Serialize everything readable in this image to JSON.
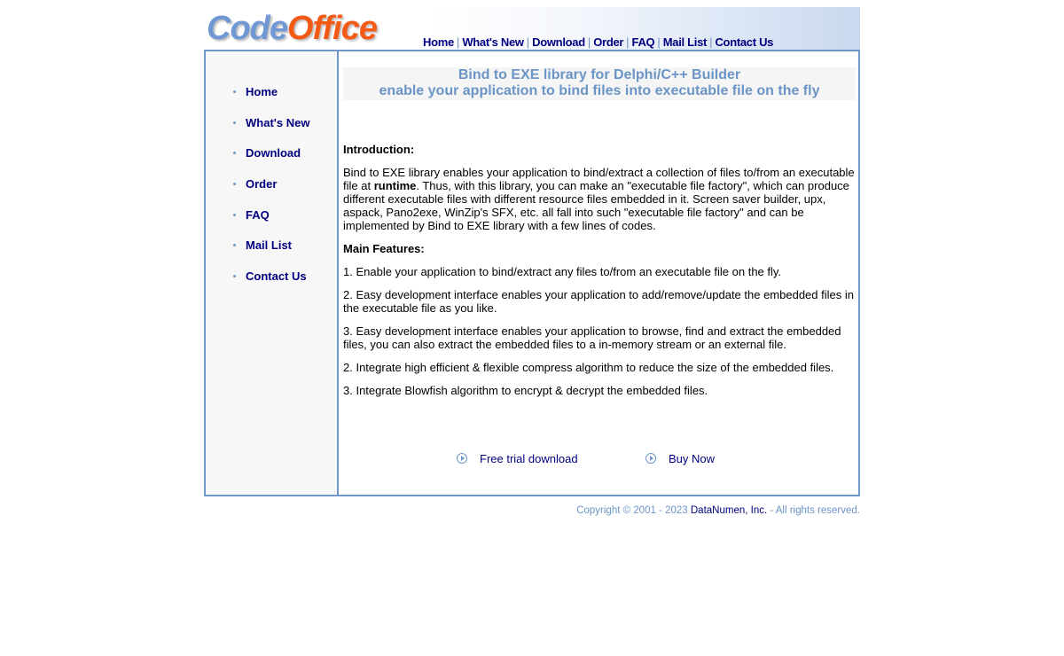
{
  "logo": {
    "part1": "Code",
    "part2": "Office"
  },
  "topnav": [
    "Home",
    "What's New",
    "Download",
    "Order",
    "FAQ",
    "Mail List",
    "Contact Us"
  ],
  "topnav_separator": "|",
  "sidebar": {
    "items": [
      "Home",
      "What's New",
      "Download",
      "Order",
      "FAQ",
      "Mail List",
      "Contact Us"
    ]
  },
  "main": {
    "title_line1": "Bind to EXE library for Delphi/C++ Builder",
    "title_line2": "enable your application to bind files into executable file on the fly",
    "intro_heading": "Introduction:",
    "intro_before_bold": "Bind to EXE library enables your application to bind/extract a collection of files to/from an executable file at ",
    "intro_bold": "runtime",
    "intro_after_bold": ". Thus, with this library, you can make an \"executable file factory\", which can produce different executable files with different resource files embedded in it. Screen saver builder, upx, aspack, Pano2exe, WinZip's SFX, etc. all fall into such \"executable file factory\" and can be implemented by Bind to EXE library with a few lines of codes.",
    "features_heading": "Main Features:",
    "features": [
      "1. Enable your application to bind/extract any files to/from an executable file on the fly.",
      "2. Easy development interface enables your application to add/remove/update the embedded files in the executable file as you like.",
      "3. Easy development interface enables your application to browse, find and extract the embedded files, you can also extract the embedded files to a in-memory stream or an external file.",
      "2. Integrate high efficient & flexible compress algorithm to reduce the size of the embedded files.",
      "3. Integrate Blowfish algorithm to encrypt & decrypt the embedded files."
    ],
    "actions": {
      "trial": "Free trial download",
      "buy": "Buy Now"
    }
  },
  "footer": {
    "before": "Copyright © 2001 - 2023 ",
    "company": "DataNumen, Inc.",
    "after": " - All rights reserved."
  },
  "colors": {
    "accent_blue": "#6f98c9",
    "title_blue": "#6b95c6",
    "link_navy": "#000080",
    "logo_orange": "#f25a16",
    "logo_blue": "#6f98d4"
  }
}
